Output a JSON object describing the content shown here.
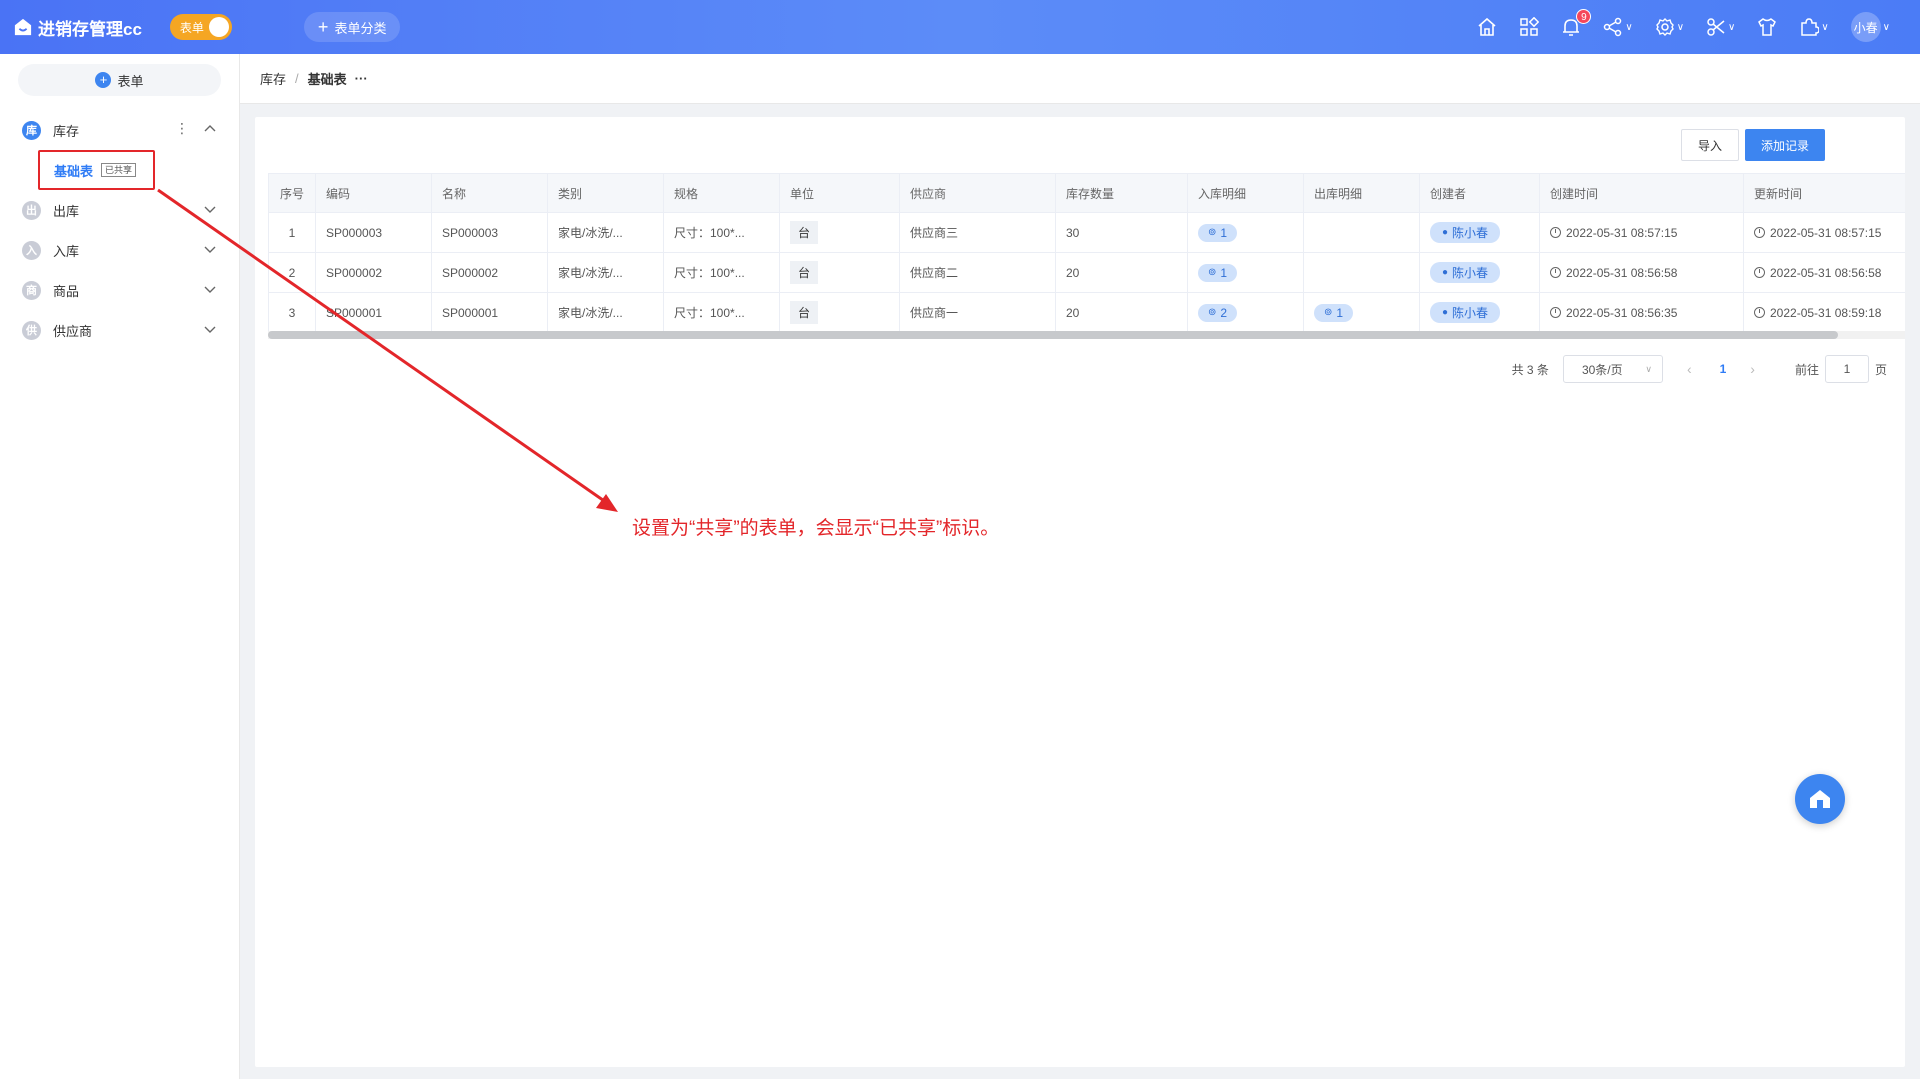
{
  "app": {
    "title": "进销存管理cc",
    "mode_label": "表单",
    "category_button": "表单分类"
  },
  "header": {
    "notification_count": "9",
    "user_name": "小春"
  },
  "sidebar": {
    "add_form_label": "表单",
    "groups": [
      {
        "icon_char": "库",
        "label": "库存",
        "active": true,
        "sub_items": [
          {
            "label": "基础表",
            "tag": "已共享"
          }
        ]
      },
      {
        "icon_char": "出",
        "label": "出库"
      },
      {
        "icon_char": "入",
        "label": "入库"
      },
      {
        "icon_char": "商",
        "label": "商品"
      },
      {
        "icon_char": "供",
        "label": "供应商"
      }
    ]
  },
  "breadcrumb": {
    "parent": "库存",
    "current": "基础表",
    "more": "···"
  },
  "toolbar": {
    "import_label": "导入",
    "add_label": "添加记录"
  },
  "table": {
    "headers": [
      "序号",
      "编码",
      "名称",
      "类别",
      "规格",
      "单位",
      "供应商",
      "库存数量",
      "入库明细",
      "出库明细",
      "创建者",
      "创建时间",
      "更新时间"
    ],
    "rows": [
      {
        "no": "1",
        "code": "SP000003",
        "name": "SP000003",
        "category": "家电/冰洗/...",
        "spec": "尺寸：100*...",
        "unit": "台",
        "supplier": "供应商三",
        "qty": "30",
        "in_detail": "1",
        "out_detail": "",
        "creator": "陈小春",
        "created": "2022-05-31 08:57:15",
        "updated": "2022-05-31 08:57:15"
      },
      {
        "no": "2",
        "code": "SP000002",
        "name": "SP000002",
        "category": "家电/冰洗/...",
        "spec": "尺寸：100*...",
        "unit": "台",
        "supplier": "供应商二",
        "qty": "20",
        "in_detail": "1",
        "out_detail": "",
        "creator": "陈小春",
        "created": "2022-05-31 08:56:58",
        "updated": "2022-05-31 08:56:58"
      },
      {
        "no": "3",
        "code": "SP000001",
        "name": "SP000001",
        "category": "家电/冰洗/...",
        "spec": "尺寸：100*...",
        "unit": "台",
        "supplier": "供应商一",
        "qty": "20",
        "in_detail": "2",
        "out_detail": "1",
        "creator": "陈小春",
        "created": "2022-05-31 08:56:35",
        "updated": "2022-05-31 08:59:18"
      }
    ]
  },
  "pagination": {
    "total": "共 3 条",
    "page_size": "30条/页",
    "current_page": "1",
    "goto_prefix": "前往",
    "goto_value": "1",
    "goto_suffix": "页"
  },
  "annotation": {
    "text": "设置为“共享”的表单，会显示“已共享”标识。",
    "color": "#e3262a"
  },
  "colors": {
    "primary": "#3d85f0",
    "toggle": "#f5a623"
  }
}
